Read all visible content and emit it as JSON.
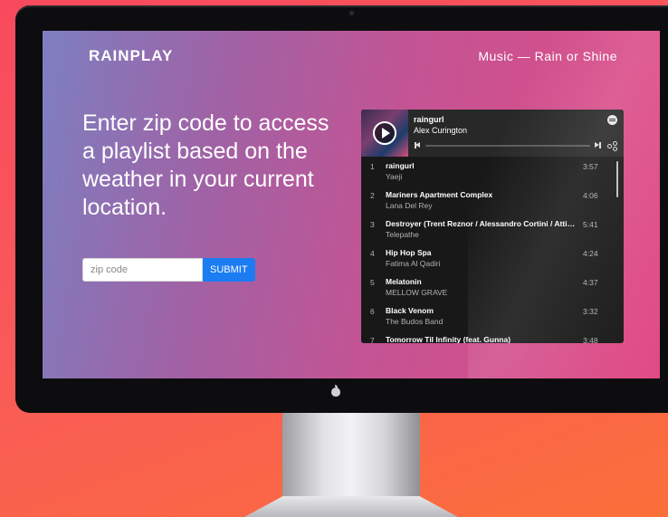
{
  "brand": {
    "logo": "RAINPLAY",
    "tagline": "Music — Rain or Shine"
  },
  "hero": {
    "headline": "Enter zip code to access a playlist based on the weather in your current location."
  },
  "form": {
    "zip_placeholder": "zip code",
    "zip_value": "",
    "submit_label": "SUBMIT"
  },
  "player": {
    "now_playing_title": "raingurl",
    "now_playing_artist": "Alex Curington",
    "progress": 0,
    "tracks": [
      {
        "num": "1",
        "title": "raingurl",
        "artist": "Yaeji",
        "duration": "3:57"
      },
      {
        "num": "2",
        "title": "Mariners Apartment Complex",
        "artist": "Lana Del Rey",
        "duration": "4:06"
      },
      {
        "num": "3",
        "title": "Destroyer (Trent Reznor / Alessandro Cortini / Atticus Ross Remix)",
        "artist": "Telepathe",
        "duration": "5:41"
      },
      {
        "num": "4",
        "title": "Hip Hop Spa",
        "artist": "Fatima Al Qadiri",
        "duration": "4:24"
      },
      {
        "num": "5",
        "title": "Melatonin",
        "artist": "MELLOW GRAVE",
        "duration": "4:37"
      },
      {
        "num": "6",
        "title": "Black Venom",
        "artist": "The Budos Band",
        "duration": "3:32"
      },
      {
        "num": "7",
        "title": "Tomorrow Til Infinity (feat. Gunna)",
        "artist": "",
        "duration": "3:48"
      }
    ]
  }
}
